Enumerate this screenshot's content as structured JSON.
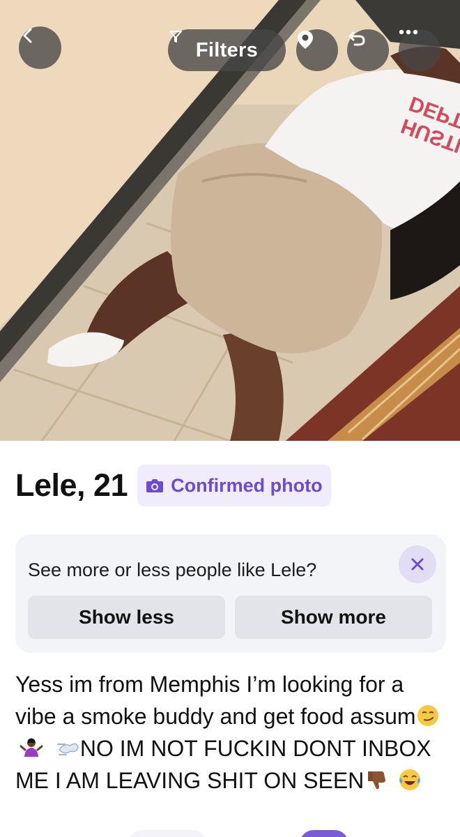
{
  "header": {
    "filters_label": "Filters",
    "back_icon": "chevron-left-icon",
    "location_icon": "location-pin-icon",
    "undo_icon": "undo-icon",
    "more_icon": "more-dots-icon"
  },
  "photo": {
    "shirt_text_line1": "HUSTLE",
    "shirt_text_line2": "DEPT."
  },
  "profile": {
    "name_age": "Lele, 21",
    "confirmed_label": "Confirmed photo"
  },
  "feedback": {
    "question": "See more or less people like Lele?",
    "show_less": "Show less",
    "show_more": "Show more"
  },
  "bio": {
    "part1": "Yess im from Memphis I’m looking for a vibe a smoke buddy and get food assum",
    "part2": "NO IM NOT FUCKIN DONT INBOX ME I AM LEAVING SHIT ON SEEN"
  },
  "colors": {
    "accent": "#6b4bd2",
    "card_bg": "#f3f4f7",
    "button_bg": "#e2e4e9",
    "overlay_btn": "#464646"
  }
}
